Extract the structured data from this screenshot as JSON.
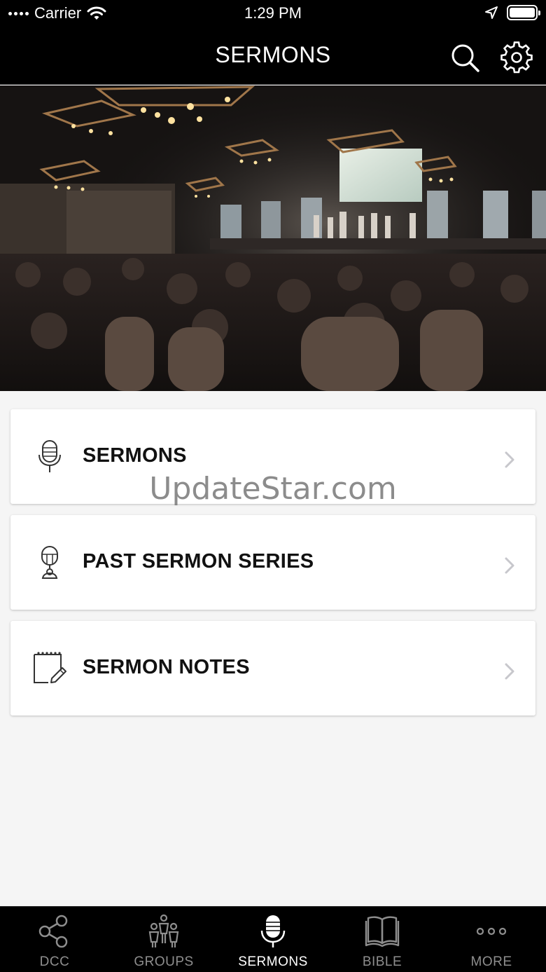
{
  "status_bar": {
    "carrier": "Carrier",
    "time": "1:29 PM",
    "battery_level": 1.0
  },
  "nav": {
    "title": "SERMONS",
    "search_icon": "search-icon",
    "settings_icon": "gear-icon"
  },
  "hero": {
    "icon": "church-worship-photo"
  },
  "watermark": "UpdateStar.com",
  "menu": {
    "items": [
      {
        "label": "SERMONS",
        "icon": "microphone-icon"
      },
      {
        "label": "PAST SERMON SERIES",
        "icon": "podcast-mic-icon"
      },
      {
        "label": "SERMON NOTES",
        "icon": "notepad-pencil-icon"
      }
    ]
  },
  "tabs": [
    {
      "label": "DCC",
      "icon": "share-icon",
      "active": false
    },
    {
      "label": "GROUPS",
      "icon": "people-icon",
      "active": false
    },
    {
      "label": "SERMONS",
      "icon": "microphone-icon",
      "active": true
    },
    {
      "label": "BIBLE",
      "icon": "book-icon",
      "active": false
    },
    {
      "label": "MORE",
      "icon": "more-dots-icon",
      "active": false
    }
  ],
  "colors": {
    "bar_background": "#000000",
    "page_background": "#f5f5f5",
    "card_background": "#ffffff",
    "tab_inactive": "#8e8e8e",
    "tab_active": "#ffffff"
  }
}
